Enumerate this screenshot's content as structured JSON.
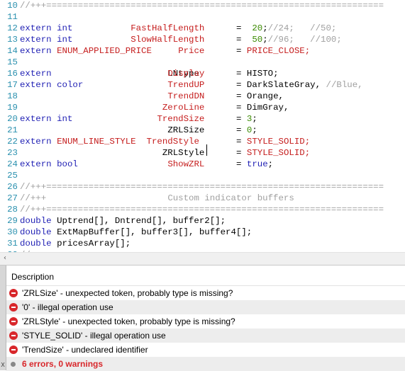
{
  "editor": {
    "lines": [
      {
        "n": "10",
        "segs": [
          {
            "t": "//+++================================================================",
            "c": "gry"
          }
        ]
      },
      {
        "n": "11",
        "segs": []
      },
      {
        "n": "12",
        "segs": [
          {
            "t": "extern",
            "c": "kw"
          },
          {
            "t": "int",
            "c": "kw"
          },
          {
            "t": "FastHalfLength",
            "c": "red"
          },
          {
            "t": "=",
            "c": "blk"
          },
          {
            "t": "20",
            "c": "grn"
          },
          {
            "t": ";",
            "c": "blk"
          },
          {
            "t": "//24;   //50;",
            "c": "gry"
          }
        ]
      },
      {
        "n": "13",
        "segs": [
          {
            "t": "extern",
            "c": "kw"
          },
          {
            "t": "int",
            "c": "kw"
          },
          {
            "t": "SlowHalfLength",
            "c": "red"
          },
          {
            "t": "=",
            "c": "blk"
          },
          {
            "t": "50",
            "c": "grn"
          },
          {
            "t": ";",
            "c": "blk"
          },
          {
            "t": "//96;   //100;",
            "c": "gry"
          }
        ]
      },
      {
        "n": "14",
        "segs": [
          {
            "t": "extern",
            "c": "kw"
          },
          {
            "t": "ENUM_APPLIED_PRICE",
            "c": "red"
          },
          {
            "t": "Price",
            "c": "red"
          },
          {
            "t": "=",
            "c": "blk"
          },
          {
            "t": "PRICE_CLOSE;",
            "c": "red"
          }
        ]
      },
      {
        "n": "15",
        "segs": []
      },
      {
        "n": "16",
        "segs": [
          {
            "t": "extern",
            "c": "kw"
          },
          {
            "t": "LNtype",
            "c": "blk"
          },
          {
            "t": "Display",
            "c": "red"
          },
          {
            "t": "=",
            "c": "blk"
          },
          {
            "t": "HISTO;",
            "c": "blk"
          }
        ]
      },
      {
        "n": "17",
        "segs": [
          {
            "t": "extern",
            "c": "kw"
          },
          {
            "t": "color",
            "c": "kw"
          },
          {
            "t": "TrendUP",
            "c": "red"
          },
          {
            "t": "=",
            "c": "blk"
          },
          {
            "t": "DarkSlateGray,",
            "c": "blk"
          },
          {
            "t": "//Blue,",
            "c": "gry"
          }
        ]
      },
      {
        "n": "18",
        "segs": [
          {
            "t": "TrendDN",
            "c": "red"
          },
          {
            "t": "=",
            "c": "blk"
          },
          {
            "t": "Orange,",
            "c": "blk"
          }
        ]
      },
      {
        "n": "19",
        "segs": [
          {
            "t": "ZeroLine",
            "c": "red"
          },
          {
            "t": "=",
            "c": "blk"
          },
          {
            "t": "DimGray,",
            "c": "blk"
          }
        ]
      },
      {
        "n": "20",
        "segs": [
          {
            "t": "extern",
            "c": "kw"
          },
          {
            "t": "int",
            "c": "kw"
          },
          {
            "t": "TrendSize",
            "c": "red"
          },
          {
            "t": "=",
            "c": "blk"
          },
          {
            "t": "3",
            "c": "grn"
          },
          {
            "t": ";",
            "c": "blk"
          }
        ]
      },
      {
        "n": "21",
        "segs": [
          {
            "t": "ZRLSize",
            "c": "blk"
          },
          {
            "t": "=",
            "c": "blk"
          },
          {
            "t": "0",
            "c": "grn"
          },
          {
            "t": ";",
            "c": "blk"
          }
        ]
      },
      {
        "n": "22",
        "segs": [
          {
            "t": "extern",
            "c": "kw"
          },
          {
            "t": "ENUM_LINE_STYLE",
            "c": "red"
          },
          {
            "t": "TrendStyle",
            "c": "red"
          },
          {
            "t": "=",
            "c": "blk"
          },
          {
            "t": "STYLE_SOLID;",
            "c": "red"
          }
        ]
      },
      {
        "n": "23",
        "segs": [
          {
            "t": "ZRLStyle",
            "c": "blk"
          },
          {
            "t": "=",
            "c": "blk"
          },
          {
            "t": "STYLE_SOLID;",
            "c": "red"
          }
        ]
      },
      {
        "n": "24",
        "segs": [
          {
            "t": "extern",
            "c": "kw"
          },
          {
            "t": "bool",
            "c": "kw"
          },
          {
            "t": "ShowZRL",
            "c": "red"
          },
          {
            "t": "=",
            "c": "blk"
          },
          {
            "t": "true",
            "c": "kw"
          },
          {
            "t": ";",
            "c": "blk"
          }
        ]
      },
      {
        "n": "25",
        "segs": []
      },
      {
        "n": "26",
        "segs": [
          {
            "t": "//+++================================================================",
            "c": "gry"
          }
        ]
      },
      {
        "n": "27",
        "segs": [
          {
            "t": "//+++",
            "c": "gry"
          },
          {
            "t": "Custom indicator buffers",
            "c": "gry"
          }
        ]
      },
      {
        "n": "28",
        "segs": [
          {
            "t": "//+++================================================================",
            "c": "gry"
          }
        ]
      },
      {
        "n": "29",
        "segs": [
          {
            "t": "double",
            "c": "kw"
          },
          {
            "t": "Uptrend[], Dntrend[], buffer2[];",
            "c": "blk"
          }
        ]
      },
      {
        "n": "30",
        "segs": [
          {
            "t": "double",
            "c": "kw"
          },
          {
            "t": "ExtMapBuffer[], buffer3[], buffer4[];",
            "c": "blk"
          }
        ]
      },
      {
        "n": "31",
        "segs": [
          {
            "t": "double",
            "c": "kw"
          },
          {
            "t": "pricesArray[];",
            "c": "blk"
          }
        ]
      },
      {
        "n": "32",
        "segs": [
          {
            "t": "//+++================================================================",
            "c": "gry"
          }
        ]
      }
    ]
  },
  "scrollbar": {
    "left_arrow": "‹"
  },
  "errors_panel": {
    "header": "Description",
    "rows": [
      "'ZRLSize' - unexpected token, probably type is missing?",
      "'0' - illegal operation use",
      "'ZRLStyle' - unexpected token, probably type is missing?",
      "'STYLE_SOLID' - illegal operation use",
      "'TrendSize' - undeclared identifier"
    ],
    "summary": "6 errors, 0 warnings",
    "side_tab_label": "X"
  },
  "colors": {
    "keyword": "#1f1fb4",
    "identifier": "#c51d1d",
    "number": "#3a8a00",
    "comment": "#a0a0a0",
    "line_number": "#2b91af",
    "error": "#d8272b"
  },
  "icons": {
    "error_row": "error-circle-icon",
    "summary": "info-dot-icon",
    "scroll_left": "chevron-left-icon"
  }
}
